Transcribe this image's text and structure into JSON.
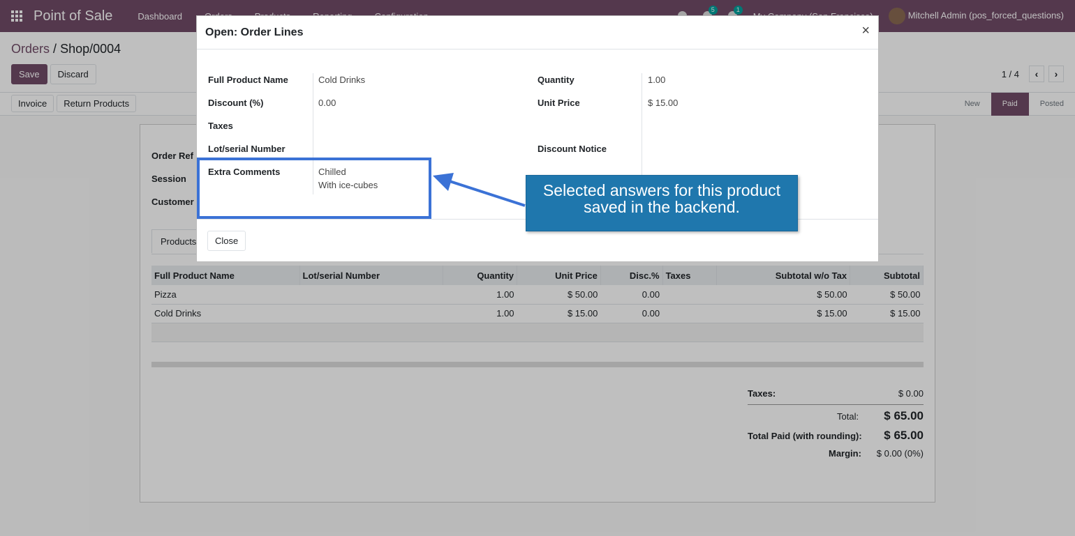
{
  "navbar": {
    "app_name": "Point of Sale",
    "menu": [
      "Dashboard",
      "Orders",
      "Products",
      "Reporting",
      "Configuration"
    ],
    "messages_count": "5",
    "activity_count": "1",
    "company": "My Company (San Francisco)",
    "user": "Mitchell Admin (pos_forced_questions)"
  },
  "breadcrumb": {
    "parent": "Orders",
    "separator": "/",
    "current": "Shop/0004"
  },
  "buttons": {
    "save": "Save",
    "discard": "Discard",
    "invoice": "Invoice",
    "return_products": "Return Products",
    "close": "Close"
  },
  "pager": {
    "text": "1 / 4"
  },
  "stages": [
    "New",
    "Paid",
    "Posted"
  ],
  "stages_active": "Paid",
  "sheet": {
    "labels": {
      "order_ref": "Order Ref",
      "session": "Session",
      "customer": "Customer"
    },
    "tab_products": "Products",
    "columns": [
      "Full Product Name",
      "Lot/serial Number",
      "Quantity",
      "Unit Price",
      "Disc.%",
      "Taxes",
      "Subtotal w/o Tax",
      "Subtotal"
    ],
    "rows": [
      {
        "name": "Pizza",
        "lot": "",
        "qty": "1.00",
        "price": "$ 50.00",
        "disc": "0.00",
        "taxes": "",
        "subtotal_wo": "$ 50.00",
        "subtotal": "$ 50.00"
      },
      {
        "name": "Cold Drinks",
        "lot": "",
        "qty": "1.00",
        "price": "$ 15.00",
        "disc": "0.00",
        "taxes": "",
        "subtotal_wo": "$ 15.00",
        "subtotal": "$ 15.00"
      }
    ],
    "totals": {
      "taxes_label": "Taxes:",
      "taxes_value": "$ 0.00",
      "total_label": "Total:",
      "total_value": "$ 65.00",
      "paid_label": "Total Paid (with rounding):",
      "paid_value": "$ 65.00",
      "margin_label": "Margin:",
      "margin_value": "$ 0.00 (0%)"
    }
  },
  "modal": {
    "title": "Open: Order Lines",
    "close_symbol": "×",
    "fields": {
      "product_label": "Full Product Name",
      "product_value": "Cold Drinks",
      "discount_label": "Discount (%)",
      "discount_value": "0.00",
      "taxes_label": "Taxes",
      "lot_label": "Lot/serial Number",
      "comments_label": "Extra Comments",
      "comments_line1": "Chilled",
      "comments_line2": "With ice-cubes",
      "quantity_label": "Quantity",
      "quantity_value": "1.00",
      "unit_price_label": "Unit Price",
      "unit_price_value": "$ 15.00",
      "discount_notice_label": "Discount Notice"
    }
  },
  "annotation": {
    "text_line1": "Selected answers for this product",
    "text_line2": "saved in the backend."
  },
  "colors": {
    "brand": "#714b67",
    "highlight": "#3b72d6",
    "callout": "#1f77ad"
  }
}
